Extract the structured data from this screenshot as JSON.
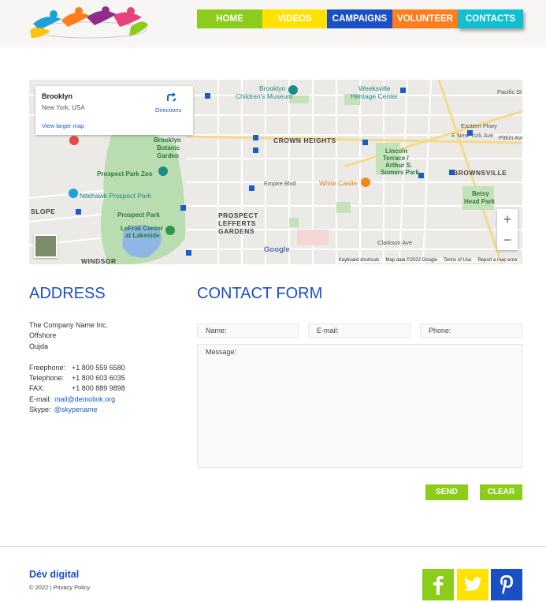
{
  "nav": {
    "home": "HOME",
    "videos": "VIDEOS",
    "campaigns": "CAMPAIGNS",
    "volunteer": "VOLUNTEER",
    "contacts": "CONTACTS"
  },
  "map": {
    "place_name": "Brooklyn",
    "place_sub": "New York, USA",
    "directions": "Directions",
    "larger_map": "View larger map",
    "labels": {
      "crown_heights": "CROWN HEIGHTS",
      "brownsville": "BROWNSVILLE",
      "prospect_lefferts": "PROSPECT",
      "prospect_lefferts2": "LEFFERTS",
      "prospect_lefferts3": "GARDENS",
      "slope": "SLOPE",
      "windsor": "WINDSOR",
      "childrens_museum": "Brooklyn",
      "childrens_museum2": "Children's Museum",
      "weeksville": "Weeksville",
      "weeksville2": "Heritage Center",
      "botanic": "Brooklyn",
      "botanic2": "Botanic",
      "botanic3": "Garden",
      "zoo": "Prospect Park Zoo",
      "nitehawk": "Nitehawk Prospect Park",
      "prospect_park": "Prospect Park",
      "lefrak": "LeFrak Center",
      "lefrak2": "at Lakeside",
      "white_castle": "White Castle",
      "lincoln": "Lincoln",
      "lincoln2": "Terrace /",
      "lincoln3": "Arthur S.",
      "lincoln4": "Somers Park",
      "betsy": "Betsy",
      "betsy2": "Head Park",
      "empire": "Empire Blvd",
      "clarkson": "Clarkson Ave",
      "pacific": "Pacific St",
      "pitkin": "Pitkin Ave",
      "eastern": "Eastern Pkwy",
      "new_york_ave": "E New York Ave"
    },
    "google": "Google",
    "attribution": {
      "shortcuts": "Keyboard shortcuts",
      "data": "Map data ©2022 Google",
      "terms": "Terms of Use",
      "report": "Report a map error"
    },
    "zoom_in": "+",
    "zoom_out": "−"
  },
  "address": {
    "title": "ADDRESS",
    "company": "The Company Name Inc.",
    "line2": "Offshore",
    "line3": "Oujda",
    "freephone_label": "Freephone:",
    "freephone": "+1 800 559 6580",
    "telephone_label": "Telephone:",
    "telephone": "+1 800 603 6035",
    "fax_label": "FAX:",
    "fax": "+1 800 889 9898",
    "email_label": "E-mail:",
    "email": "mail@demolink.org",
    "skype_label": "Skype:",
    "skype": "@skypename"
  },
  "form": {
    "title": "CONTACT FORM",
    "name": "Name:",
    "email": "E-mail:",
    "phone": "Phone:",
    "message": "Message:",
    "send": "SEND",
    "clear": "CLEAR"
  },
  "footer": {
    "brand": "Dév digital",
    "copyright": "© 2022 | Privacy Policy"
  },
  "colors": {
    "green": "#8ccc1a",
    "yellow": "#ffe200",
    "blue": "#1b4fc4",
    "orange": "#ff7d1a",
    "cyan": "#11bfd0"
  }
}
